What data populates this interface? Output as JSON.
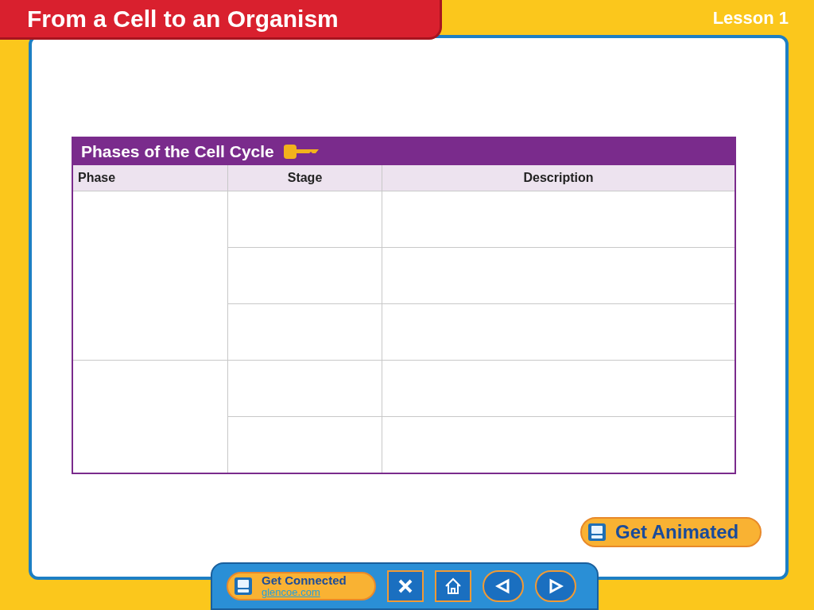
{
  "title": "From a Cell to an Organism",
  "lesson": "Lesson 1",
  "table": {
    "title": "Phases of the Cell Cycle",
    "columns": [
      "Phase",
      "Stage",
      "Description"
    ]
  },
  "animated_button": "Get Animated",
  "nav": {
    "connected_title": "Get Connected",
    "connected_link": "glencoe.com"
  }
}
